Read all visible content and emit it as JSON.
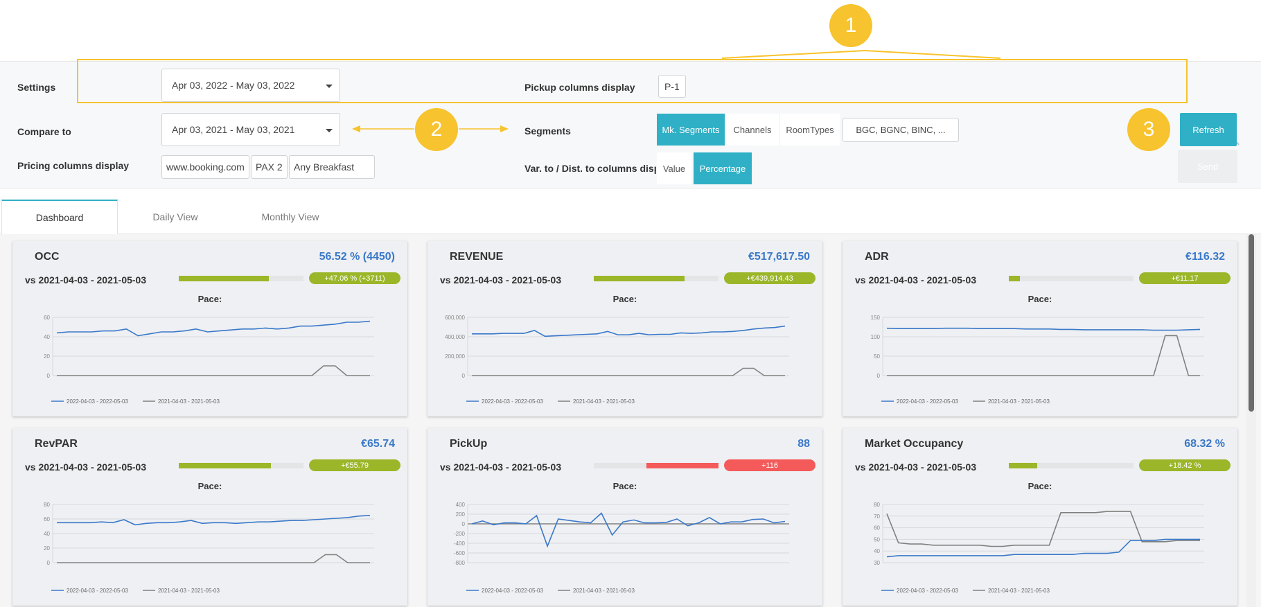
{
  "settings": {
    "label": "Settings",
    "date_range": "Apr 03, 2022 - May 03, 2022",
    "pickup_label": "Pickup columns display",
    "pickup_value": "P-1",
    "compare_label": "Compare to",
    "compare_range": "Apr 03, 2021 - May 03, 2021",
    "segments_label": "Segments",
    "segment_tabs": [
      "Mk. Segments",
      "Channels",
      "RoomTypes"
    ],
    "segment_filter": "BGC, BGNC, BINC, ...",
    "pricing_label": "Pricing columns display",
    "pricing_chips": [
      "www.booking.com",
      "PAX 2",
      "Any Breakfast"
    ],
    "var_label": "Var. to / Dist. to columns display",
    "var_options": [
      "Value",
      "Percentage"
    ],
    "refresh_label": "Refresh",
    "send_label": "Send"
  },
  "annotations": [
    "1",
    "2",
    "3"
  ],
  "tabs": [
    "Dashboard",
    "Daily View",
    "Monthly View"
  ],
  "colors": {
    "accent": "#2fb0c6",
    "positive": "#9bb628",
    "negative": "#f45a5a",
    "value_blue": "#3a78c9",
    "annotation": "#f7c32e",
    "series_current": "#3a78c9",
    "series_compare": "#808080"
  },
  "cards": [
    {
      "title": "OCC",
      "value": "56.52 % (4450)",
      "vs": "vs 2021-04-03 - 2021-05-03",
      "bar_fraction": 0.72,
      "negative": false,
      "badge": "+47.06 % (+3711)",
      "pace": "Pace:"
    },
    {
      "title": "REVENUE",
      "value": "€517,617.50",
      "vs": "vs 2021-04-03 - 2021-05-03",
      "bar_fraction": 0.73,
      "negative": false,
      "badge": "+€439,914.43",
      "pace": "Pace:"
    },
    {
      "title": "ADR",
      "value": "€116.32",
      "vs": "vs 2021-04-03 - 2021-05-03",
      "bar_fraction": 0.09,
      "negative": false,
      "badge": "+€11.17",
      "pace": "Pace:"
    },
    {
      "title": "RevPAR",
      "value": "€65.74",
      "vs": "vs 2021-04-03 - 2021-05-03",
      "bar_fraction": 0.74,
      "negative": false,
      "badge": "+€55.79",
      "pace": "Pace:"
    },
    {
      "title": "PickUp",
      "value": "88",
      "vs": "vs 2021-04-03 - 2021-05-03",
      "bar_fraction": 0.58,
      "negative": true,
      "badge": "+116",
      "pace": "Pace:"
    },
    {
      "title": "Market Occupancy",
      "value": "68.32 %",
      "vs": "vs 2021-04-03 - 2021-05-03",
      "bar_fraction": 0.23,
      "negative": false,
      "badge": "+18.42 %",
      "pace": "Pace:"
    }
  ],
  "chart_data": [
    {
      "type": "line",
      "title": "OCC",
      "yticks": [
        "0",
        "20",
        "40",
        "60"
      ],
      "ylim": [
        0,
        60
      ],
      "series": [
        {
          "name": "2022-04-03 - 2022-05-03",
          "values": [
            44,
            45,
            45,
            45,
            46,
            46,
            48,
            41,
            43,
            45,
            45,
            46,
            48,
            45,
            46,
            47,
            48,
            48,
            49,
            48,
            49,
            51,
            51,
            52,
            53,
            55,
            55,
            56
          ]
        },
        {
          "name": "2021-04-03 - 2021-05-03",
          "values": [
            0,
            0,
            0,
            0,
            0,
            0,
            0,
            0,
            0,
            0,
            0,
            0,
            0,
            0,
            0,
            0,
            0,
            0,
            0,
            0,
            0,
            0,
            0,
            10,
            10,
            0,
            0,
            0
          ]
        }
      ]
    },
    {
      "type": "line",
      "title": "REVENUE",
      "yticks": [
        "0",
        "200,000",
        "400,000",
        "600,000"
      ],
      "ylim": [
        0,
        600000
      ],
      "series": [
        {
          "name": "2022-04-03 - 2022-05-03",
          "values": [
            430000,
            430000,
            430000,
            435000,
            435000,
            435000,
            465000,
            405000,
            410000,
            415000,
            420000,
            425000,
            430000,
            455000,
            420000,
            420000,
            435000,
            420000,
            425000,
            425000,
            440000,
            435000,
            440000,
            450000,
            450000,
            455000,
            465000,
            480000,
            490000,
            495000,
            510000
          ]
        },
        {
          "name": "2021-04-03 - 2021-05-03",
          "values": [
            0,
            0,
            0,
            0,
            0,
            0,
            0,
            0,
            0,
            0,
            0,
            0,
            0,
            0,
            0,
            0,
            0,
            0,
            0,
            0,
            0,
            0,
            0,
            0,
            0,
            0,
            75000,
            75000,
            0,
            0,
            0
          ]
        }
      ]
    },
    {
      "type": "line",
      "title": "ADR",
      "yticks": [
        "0",
        "50",
        "100",
        "150"
      ],
      "ylim": [
        0,
        150
      ],
      "series": [
        {
          "name": "2022-04-03 - 2022-05-03",
          "values": [
            122,
            121,
            121,
            121,
            121,
            122,
            122,
            122,
            121,
            121,
            121,
            121,
            120,
            120,
            120,
            119,
            119,
            118,
            118,
            118,
            118,
            118,
            118,
            117,
            117,
            117,
            118,
            119
          ]
        },
        {
          "name": "2021-04-03 - 2021-05-03",
          "values": [
            0,
            0,
            0,
            0,
            0,
            0,
            0,
            0,
            0,
            0,
            0,
            0,
            0,
            0,
            0,
            0,
            0,
            0,
            0,
            0,
            0,
            0,
            0,
            0,
            103,
            103,
            0,
            0
          ]
        }
      ]
    },
    {
      "type": "line",
      "title": "RevPAR",
      "yticks": [
        "0",
        "20",
        "40",
        "60",
        "80"
      ],
      "ylim": [
        0,
        80
      ],
      "series": [
        {
          "name": "2022-04-03 - 2022-05-03",
          "values": [
            55,
            55,
            55,
            55,
            56,
            55,
            59,
            52,
            54,
            55,
            55,
            56,
            58,
            54,
            55,
            55,
            54,
            55,
            56,
            56,
            57,
            58,
            58,
            59,
            60,
            61,
            62,
            64,
            65
          ]
        },
        {
          "name": "2021-04-03 - 2021-05-03",
          "values": [
            0,
            0,
            0,
            0,
            0,
            0,
            0,
            0,
            0,
            0,
            0,
            0,
            0,
            0,
            0,
            0,
            0,
            0,
            0,
            0,
            0,
            0,
            0,
            0,
            11,
            11,
            0,
            0,
            0
          ]
        }
      ]
    },
    {
      "type": "line",
      "title": "PickUp",
      "yticks": [
        "-800",
        "-600",
        "-400",
        "-200",
        "0",
        "200",
        "400"
      ],
      "ylim": [
        -800,
        400
      ],
      "series": [
        {
          "name": "2022-04-03 - 2022-05-03",
          "values": [
            0,
            60,
            -20,
            20,
            20,
            0,
            170,
            -460,
            100,
            70,
            40,
            20,
            220,
            -230,
            40,
            80,
            20,
            20,
            30,
            100,
            -40,
            20,
            130,
            0,
            40,
            40,
            90,
            100,
            20,
            50
          ]
        },
        {
          "name": "2021-04-03 - 2021-05-03",
          "values": [
            0,
            0,
            0,
            0,
            0,
            0,
            0,
            0,
            0,
            0,
            0,
            0,
            0,
            0,
            0,
            0,
            0,
            0,
            0,
            0,
            0,
            0,
            0,
            0,
            0,
            0,
            0,
            0,
            0,
            0
          ]
        }
      ]
    },
    {
      "type": "line",
      "title": "Market Occupancy",
      "yticks": [
        "30",
        "40",
        "50",
        "60",
        "70",
        "80"
      ],
      "ylim": [
        30,
        80
      ],
      "series": [
        {
          "name": "2022-04-03 - 2022-05-03",
          "values": [
            35,
            36,
            36,
            36,
            36,
            36,
            36,
            36,
            36,
            36,
            36,
            37,
            37,
            37,
            37,
            37,
            37,
            38,
            38,
            38,
            39,
            49,
            49,
            49,
            50,
            50,
            50,
            50
          ]
        },
        {
          "name": "2021-04-03 - 2021-05-03",
          "values": [
            72,
            47,
            46,
            46,
            45,
            45,
            45,
            45,
            45,
            44,
            44,
            45,
            45,
            45,
            45,
            73,
            73,
            73,
            73,
            74,
            74,
            74,
            48,
            48,
            48,
            49,
            49,
            49
          ]
        }
      ]
    }
  ]
}
